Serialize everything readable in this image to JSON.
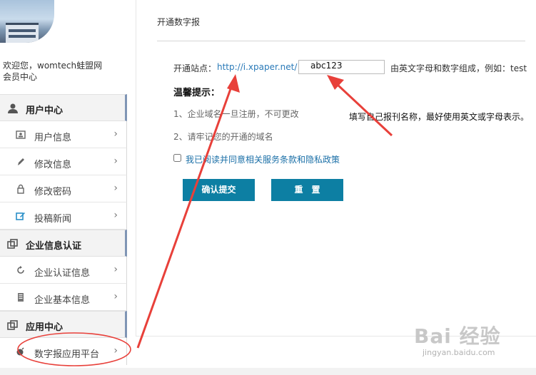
{
  "sidebar": {
    "welcome": "欢迎您，womtech蛙盟网",
    "member_center": "会员中心",
    "sections": [
      {
        "label": "用户中心",
        "icon": "user-icon",
        "items": [
          {
            "label": "用户信息",
            "icon": "id-card-icon"
          },
          {
            "label": "修改信息",
            "icon": "pencil-icon"
          },
          {
            "label": "修改密码",
            "icon": "lock-icon"
          },
          {
            "label": "投稿新闻",
            "icon": "edit-icon"
          }
        ]
      },
      {
        "label": "企业信息认证",
        "icon": "copy-icon",
        "items": [
          {
            "label": "企业认证信息",
            "icon": "refresh-icon"
          },
          {
            "label": "企业基本信息",
            "icon": "document-icon"
          }
        ]
      },
      {
        "label": "应用中心",
        "icon": "copy-icon",
        "items": [
          {
            "label": "数字报应用平台",
            "icon": "bomb-icon"
          }
        ]
      }
    ]
  },
  "main": {
    "title": "开通数字报",
    "site_label": "开通站点：",
    "site_url": "http://i.xpaper.net/",
    "site_value": "abc123",
    "site_hint": "由英文字母和数字组成，例如：test",
    "tips_title": "温馨提示：",
    "tips": [
      "1、企业域名一旦注册，不可更改",
      "2、请牢记您的开通的域名"
    ],
    "agree_text": "我已阅读并同意相关服务条款和隐私政策",
    "submit_label": "确认提交",
    "reset_label": "重　置",
    "annotation": "填写自己报刊名称，最好使用英文或字母表示。"
  },
  "watermark": {
    "main": "Bai 经验",
    "sub": "jingyan.baidu.com"
  },
  "colors": {
    "button": "#0d7fa3",
    "link": "#2a7ab8",
    "arrow": "#e8403a",
    "section_accent": "#7f95b5"
  }
}
